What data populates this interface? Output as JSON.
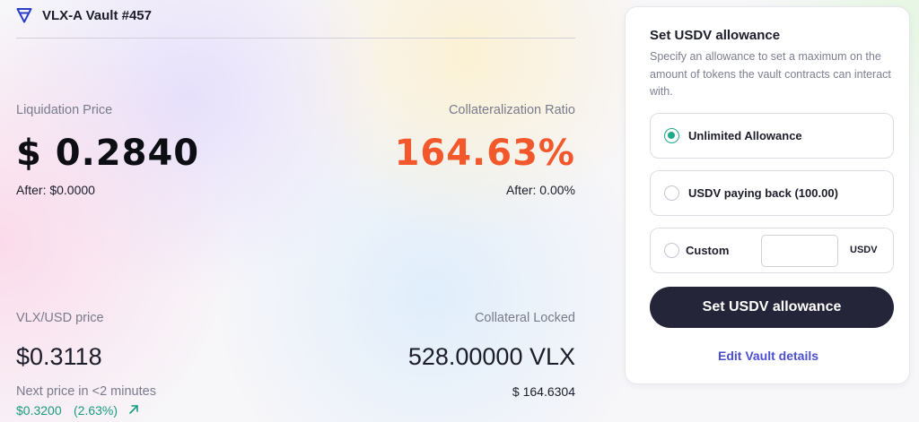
{
  "header": {
    "logo_icon": "velas-triangle-logo-icon",
    "title": "VLX-A Vault #457"
  },
  "metrics": {
    "liquidation_price": {
      "label": "Liquidation Price",
      "value": "$ 0.2840",
      "after": "After: $0.0000"
    },
    "collateralization_ratio": {
      "label": "Collateralization Ratio",
      "value": "164.63%",
      "after": "After: 0.00%",
      "color": "#f2582b"
    },
    "vlx_usd_price": {
      "label": "VLX/USD price",
      "value": "$0.3118",
      "next_label": "Next price in <2 minutes",
      "next_value": "$0.3200",
      "next_change": "(2.63%)",
      "next_icon": "arrow-up-right-icon",
      "color": "#1a9c7e"
    },
    "collateral_locked": {
      "label": "Collateral Locked",
      "value": "528.00000 VLX",
      "usd_value": "$ 164.6304"
    }
  },
  "allowance_panel": {
    "title": "Set USDV allowance",
    "description": "Specify an allowance to set a maximum on the amount of tokens the vault contracts can interact with.",
    "options": [
      {
        "label": "Unlimited Allowance",
        "selected": true
      },
      {
        "label": "USDV paying back (100.00)",
        "selected": false
      },
      {
        "label": "Custom",
        "selected": false
      }
    ],
    "custom_input": {
      "value": "",
      "placeholder": "",
      "unit": "USDV"
    },
    "submit_label": "Set USDV allowance",
    "edit_link": "Edit Vault details",
    "accent_color": "#22a88a",
    "button_color": "#252539",
    "link_color": "#4c4fcf"
  }
}
